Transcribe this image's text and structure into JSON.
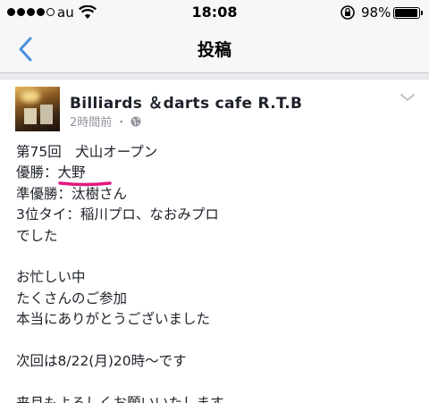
{
  "status_bar": {
    "carrier": "au",
    "time": "18:08",
    "battery": "98%",
    "battery_level": 0.98,
    "signal_bars": 4,
    "signal_total": 5
  },
  "nav": {
    "title": "投稿",
    "back_icon": "chevron-left-icon"
  },
  "post": {
    "page_name": "Billiards ＆darts cafe R.T.B",
    "timestamp": "2時間前",
    "separator": "・",
    "privacy_icon": "globe-icon",
    "menu_icon": "chevron-down-icon",
    "lines": {
      "l1": "第75回　犬山オープン",
      "l2_prefix": "優勝：",
      "l2_name": "大野",
      "l3": "準優勝：汰樹さん",
      "l4": "3位タイ：稲川プロ、なおみプロ",
      "l5": "でした",
      "l7": "お忙しい中",
      "l8": "たくさんのご参加",
      "l9": "本当にありがとうございました",
      "l11": "次回は8/22(月)20時〜です",
      "l13": "来月もよろしくお願いいたします"
    }
  },
  "colors": {
    "accent": "#4a90e2",
    "highlight_mark": "#e0187f",
    "meta_text": "#90949c"
  }
}
